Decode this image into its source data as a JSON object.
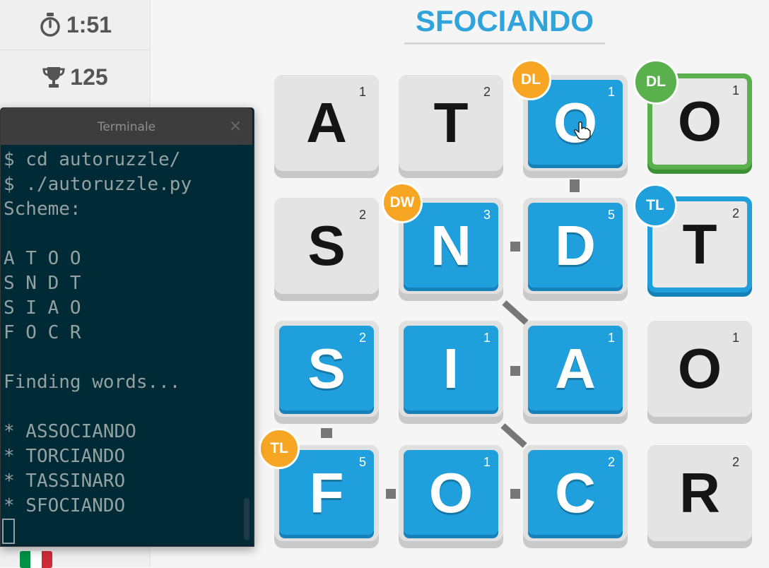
{
  "stats": {
    "timer": "1:51",
    "score": "125",
    "timer_icon": "stopwatch-icon",
    "score_icon": "trophy-icon",
    "flag_colors": [
      "#009246",
      "#ffffff",
      "#ce2b37"
    ]
  },
  "current_word": "SFOCIANDO",
  "colors": {
    "accent_blue": "#1f9fdc",
    "bonus_orange": "#f6a623",
    "bonus_green": "#5ab04d",
    "bonus_blue": "#1f9fdc"
  },
  "board": {
    "rows": [
      [
        {
          "letter": "A",
          "points": "1"
        },
        {
          "letter": "T",
          "points": "2"
        },
        {
          "letter": "O",
          "points": "1",
          "bonus": "DL"
        },
        {
          "letter": "O",
          "points": "1",
          "bonus": "DL"
        }
      ],
      [
        {
          "letter": "S",
          "points": "2"
        },
        {
          "letter": "N",
          "points": "3",
          "bonus": "DW"
        },
        {
          "letter": "D",
          "points": "5"
        },
        {
          "letter": "T",
          "points": "2",
          "bonus": "TL"
        }
      ],
      [
        {
          "letter": "S",
          "points": "2"
        },
        {
          "letter": "I",
          "points": "1"
        },
        {
          "letter": "A",
          "points": "1"
        },
        {
          "letter": "O",
          "points": "1"
        }
      ],
      [
        {
          "letter": "F",
          "points": "5",
          "bonus": "TL"
        },
        {
          "letter": "O",
          "points": "1"
        },
        {
          "letter": "C",
          "points": "2"
        },
        {
          "letter": "R",
          "points": "2"
        }
      ]
    ]
  },
  "terminal": {
    "title": "Terminale",
    "close_label": "×",
    "lines": [
      "$ cd autoruzzle/",
      "$ ./autoruzzle.py",
      "Scheme:",
      "",
      "A T O O",
      "S N D T",
      "S I A O",
      "F O C R",
      "",
      "Finding words...",
      "",
      "* ASSOCIANDO",
      "* TORCIANDO",
      "* TASSINARO",
      "* SFOCIANDO"
    ]
  }
}
